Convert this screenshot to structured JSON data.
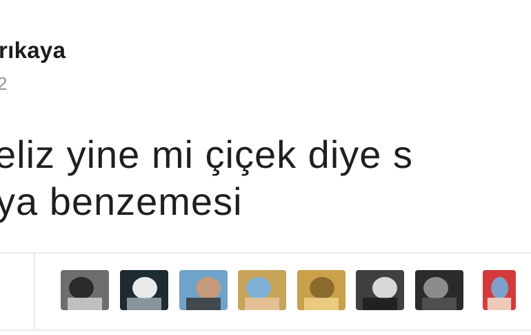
{
  "tweet": {
    "author_name": "rıkaya",
    "author_handle": "2",
    "text_lines": [
      "eliz yine mi çiçek diye s",
      "ya benzemesi"
    ]
  },
  "likers": {
    "avatars": [
      {
        "name": "avatar-1",
        "colors": [
          "#6e6e6e",
          "#2a2a2a",
          "#cfcfcf"
        ]
      },
      {
        "name": "avatar-2",
        "colors": [
          "#1d2b33",
          "#e9e9e9",
          "#9aa7ae"
        ]
      },
      {
        "name": "avatar-3",
        "colors": [
          "#6fa3c9",
          "#c59a7b",
          "#3a3a3a"
        ]
      },
      {
        "name": "avatar-4",
        "colors": [
          "#c8a35a",
          "#7fb1d9",
          "#e8c59f"
        ]
      },
      {
        "name": "avatar-5",
        "colors": [
          "#caa04a",
          "#8a6a2e",
          "#f0d08a"
        ]
      },
      {
        "name": "avatar-6",
        "colors": [
          "#404040",
          "#d8d8d8",
          "#1c1c1c"
        ]
      },
      {
        "name": "avatar-7",
        "colors": [
          "#2b2b2b",
          "#8c8c8c",
          "#555555"
        ]
      },
      {
        "name": "avatar-8",
        "colors": [
          "#d53a3a",
          "#7da2c9",
          "#f2e4d2"
        ]
      }
    ]
  }
}
